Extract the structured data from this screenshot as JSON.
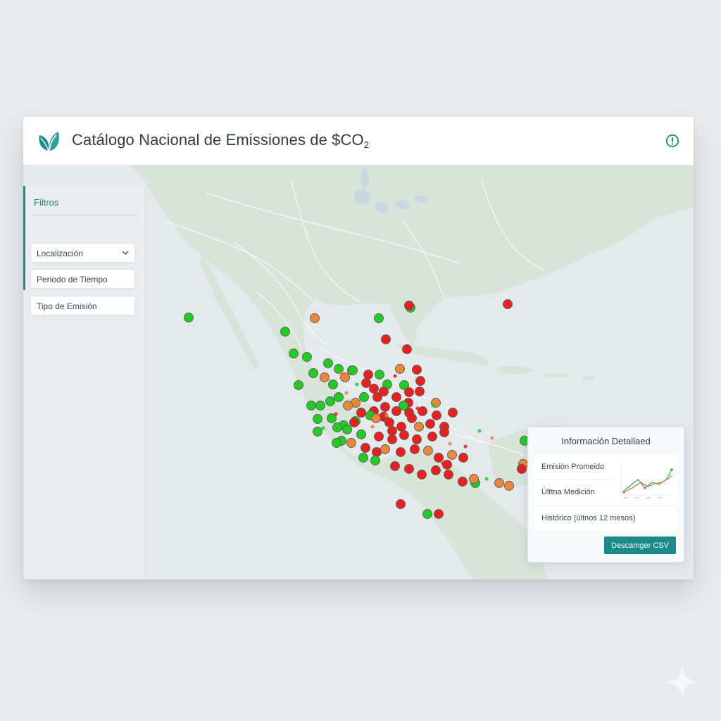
{
  "header": {
    "title": "Catálogo Nacional de Emissiones de $CO",
    "title_subscript": "2",
    "logo_icon": "leaf-logo-icon",
    "info_icon": "info-icon"
  },
  "sidebar": {
    "title": "Filtros",
    "filters": [
      {
        "label": "Localización",
        "has_dropdown": true
      },
      {
        "label": "Periodo de Tiempo",
        "has_dropdown": false
      },
      {
        "label": "Tipo de Emisión",
        "has_dropdown": false
      }
    ]
  },
  "detail_panel": {
    "title": "Información Detallaed",
    "rows": [
      "Emisión Promeido",
      "Últtna Medición",
      "Histórico (últnos 12 mesos)"
    ],
    "download_label": "Descamger CSV"
  },
  "colors": {
    "accent": "#1b8a8a",
    "marker_low": "#22cc22",
    "marker_mid": "#e8883a",
    "marker_high": "#e8201e"
  }
}
